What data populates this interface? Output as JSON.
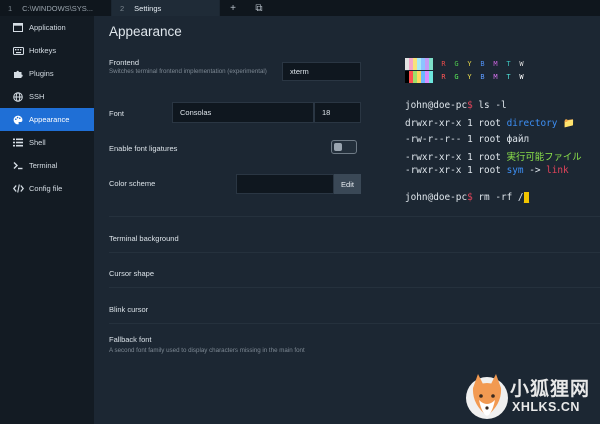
{
  "tabs": [
    {
      "num": "1",
      "title": "C:\\WINDOWS\\SYS..."
    },
    {
      "num": "2",
      "title": "Settings"
    }
  ],
  "tab_actions": {
    "new_tab": "+",
    "window": "⧉"
  },
  "sidebar": {
    "items": [
      {
        "label": "Application",
        "icon": "window-icon"
      },
      {
        "label": "Hotkeys",
        "icon": "keyboard-icon"
      },
      {
        "label": "Plugins",
        "icon": "puzzle-icon"
      },
      {
        "label": "SSH",
        "icon": "globe-icon"
      },
      {
        "label": "Appearance",
        "icon": "palette-icon"
      },
      {
        "label": "Shell",
        "icon": "list-icon"
      },
      {
        "label": "Terminal",
        "icon": "terminal-icon"
      },
      {
        "label": "Config file",
        "icon": "code-icon"
      }
    ],
    "active": "Appearance"
  },
  "main": {
    "title": "Appearance",
    "frontend": {
      "label": "Frontend",
      "sub": "Switches terminal frontend implementation (experimental)",
      "value": "xterm"
    },
    "font": {
      "label": "Font",
      "family": "Consolas",
      "size": "18"
    },
    "ligatures": {
      "label": "Enable font ligatures",
      "enabled": false
    },
    "color_scheme": {
      "label": "Color scheme",
      "value": "",
      "edit": "Edit"
    },
    "terminal_background": {
      "label": "Terminal background"
    },
    "cursor_shape": {
      "label": "Cursor shape"
    },
    "blink_cursor": {
      "label": "Blink cursor"
    },
    "fallback_font": {
      "label": "Fallback font",
      "sub": "A second font family used to display characters missing in the main font"
    }
  },
  "preview": {
    "palette_row1": {
      "swatches": [
        "#e3e3e3",
        "#f4a6c8",
        "#f7e27a",
        "#a7e8f5",
        "#8cc4ff",
        "#c39bf5",
        "#7ee0c9"
      ],
      "letters": [
        "R",
        "G",
        "Y",
        "B",
        "M",
        "T",
        "W"
      ],
      "letter_colors": [
        "#e34b4b",
        "#4ec94e",
        "#e3d34a",
        "#4f8ef0",
        "#c561d8",
        "#3dc7c0",
        "#d9d9d9"
      ]
    },
    "palette_row2": {
      "swatches": [
        "#000000",
        "#ff4f4f",
        "#9ee06a",
        "#ffd65c",
        "#6ab7ff",
        "#d98cff",
        "#6de7de"
      ],
      "letters": [
        "R",
        "G",
        "Y",
        "B",
        "M",
        "T",
        "W"
      ],
      "letter_colors": [
        "#ff5555",
        "#5af05a",
        "#f0e050",
        "#5d9bff",
        "#d672ee",
        "#4fe0d8",
        "#ffffff"
      ]
    },
    "prompt": "john@doe-pc",
    "prompt_sym": "$",
    "cmd1": " ls -l",
    "lines": [
      {
        "perm": "drwxr-xr-x",
        "links": "1",
        "owner": "root",
        "name": "directory",
        "color": "#3d8ff5",
        "suffix": "📁"
      },
      {
        "perm": "-rw-r--r--",
        "links": "1",
        "owner": "root",
        "name": "файл",
        "color": "#dfe6ec",
        "suffix": ""
      },
      {
        "perm": "-rwxr-xr-x",
        "links": "1",
        "owner": "root",
        "name": "実行可能ファイル",
        "color": "#8ee64a",
        "suffix": ""
      },
      {
        "perm": "-rwxr-xr-x",
        "links": "1",
        "owner": "root",
        "name": "sym",
        "color": "#3d8ff5",
        "suffix": " -> ",
        "target": "link",
        "target_color": "#e0435a"
      }
    ],
    "cmd2": " rm -rf /",
    "colors": {
      "prompt": "#dfe6ec",
      "cursor": "#f2c500"
    }
  },
  "watermark": {
    "cn": "小狐狸网",
    "en": "XHLKS.CN"
  },
  "colors": {
    "accent": "#1f6fd6",
    "background": "#1c2733",
    "sidebar": "#131b23"
  }
}
